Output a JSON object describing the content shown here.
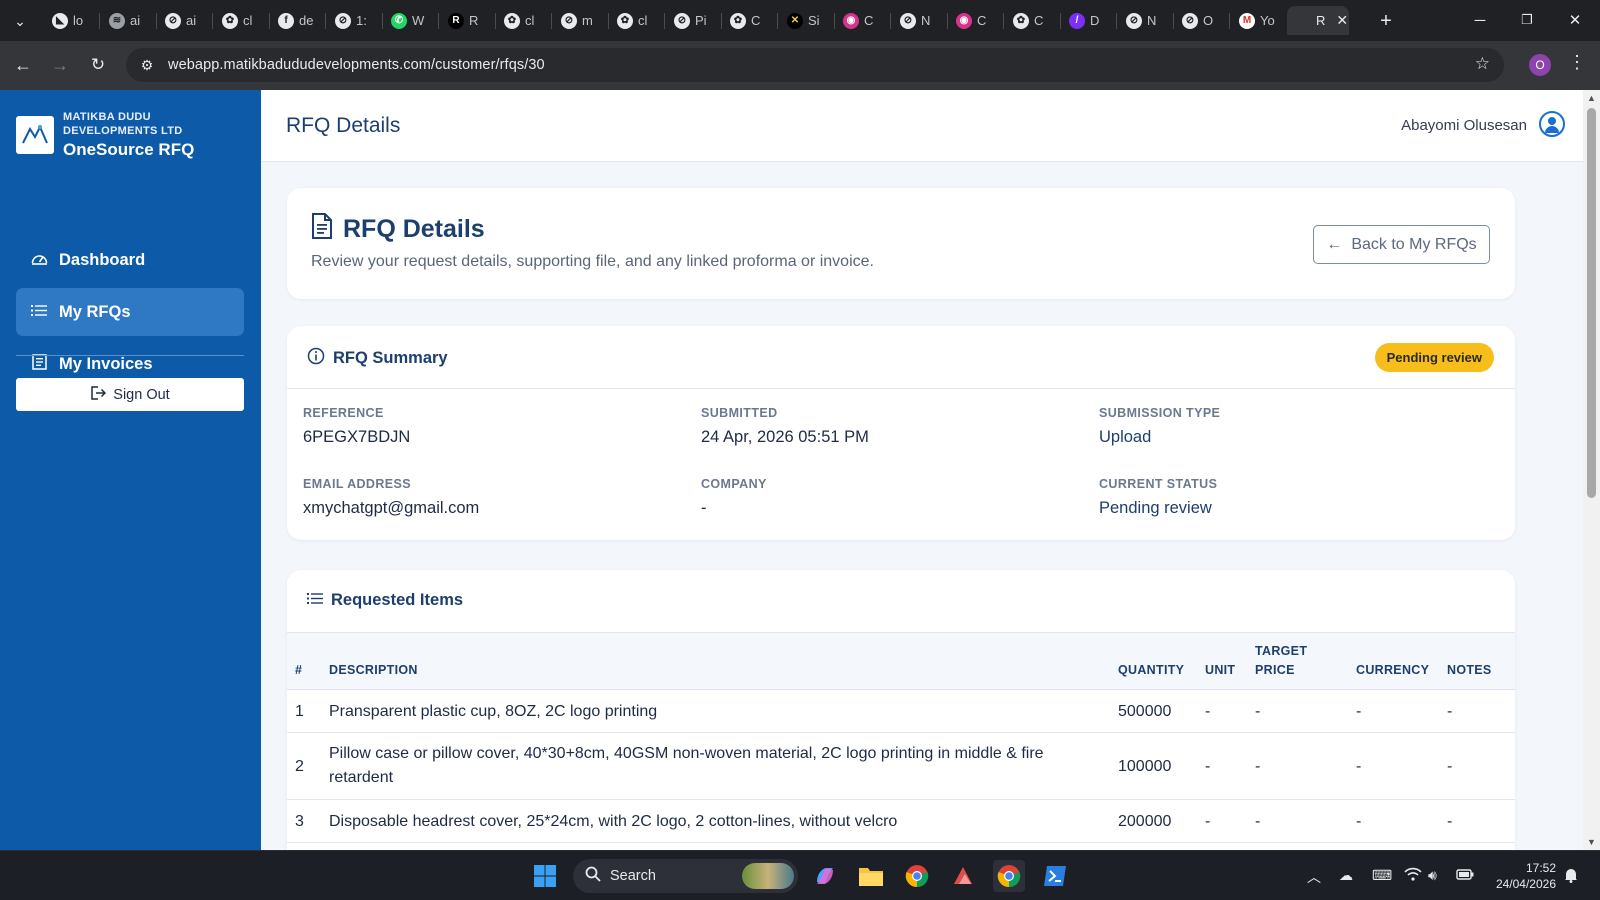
{
  "browser": {
    "tabs": [
      {
        "label": "lo",
        "icon": "pdf-icon"
      },
      {
        "label": "ai",
        "icon": "sketch-icon"
      },
      {
        "label": "ai",
        "icon": "chatgpt-icon"
      },
      {
        "label": "cl",
        "icon": "openai-icon"
      },
      {
        "label": "de",
        "icon": "facebook-icon"
      },
      {
        "label": "1:",
        "icon": "chatgpt-icon"
      },
      {
        "label": "W",
        "icon": "whatsapp-icon"
      },
      {
        "label": "R",
        "icon": "r-icon"
      },
      {
        "label": "cl",
        "icon": "openai-icon"
      },
      {
        "label": "m",
        "icon": "chatgpt-icon"
      },
      {
        "label": "cl",
        "icon": "openai-icon"
      },
      {
        "label": "Pi",
        "icon": "chatgpt-icon"
      },
      {
        "label": "C",
        "icon": "openai-icon"
      },
      {
        "label": "Si",
        "icon": "x-icon"
      },
      {
        "label": "C",
        "icon": "copilot-icon"
      },
      {
        "label": "N",
        "icon": "chatgpt-icon"
      },
      {
        "label": "C",
        "icon": "copilot-icon"
      },
      {
        "label": "C",
        "icon": "openai-icon"
      },
      {
        "label": "D",
        "icon": "purple-icon"
      },
      {
        "label": "N",
        "icon": "chatgpt-icon"
      },
      {
        "label": "O",
        "icon": "chatgpt-icon"
      },
      {
        "label": "Yo",
        "icon": "gmail-icon"
      },
      {
        "label": "R",
        "icon": "blank-icon",
        "active": true
      }
    ],
    "url": "webapp.matikbadududevelopments.com/customer/rfqs/30",
    "profile_initial": "O"
  },
  "sidebar": {
    "company_line1": "MATIKBA DUDU",
    "company_line2": "DEVELOPMENTS LTD",
    "app_name": "OneSource RFQ",
    "items": [
      {
        "label": "Dashboard",
        "icon": "dashboard-icon",
        "active": false
      },
      {
        "label": "My RFQs",
        "icon": "list-icon",
        "active": true
      },
      {
        "label": "My Invoices",
        "icon": "invoice-icon",
        "active": false
      }
    ],
    "signout_label": "Sign Out"
  },
  "topbar": {
    "title": "RFQ Details",
    "user_name": "Abayomi Olusesan"
  },
  "header_card": {
    "title": "RFQ Details",
    "subtitle": "Review your request details, supporting file, and any linked proforma or invoice.",
    "back_label": "Back to My RFQs"
  },
  "summary": {
    "title": "RFQ Summary",
    "status_badge": "Pending review",
    "status_color": "#f7bd1a",
    "fields": {
      "reference": {
        "label": "REFERENCE",
        "value": "6PEGX7BDJN"
      },
      "submitted": {
        "label": "SUBMITTED",
        "value": "24 Apr, 2026 05:51 PM"
      },
      "submission_type": {
        "label": "SUBMISSION TYPE",
        "value": "Upload"
      },
      "email": {
        "label": "EMAIL ADDRESS",
        "value": "xmychatgpt@gmail.com"
      },
      "company": {
        "label": "COMPANY",
        "value": "-"
      },
      "current_status": {
        "label": "CURRENT STATUS",
        "value": "Pending review"
      }
    }
  },
  "items": {
    "title": "Requested Items",
    "columns": {
      "num": "#",
      "description": "DESCRIPTION",
      "quantity": "QUANTITY",
      "unit": "UNIT",
      "target_price_1": "TARGET",
      "target_price_2": "PRICE",
      "currency": "CURRENCY",
      "notes": "NOTES"
    },
    "rows": [
      {
        "num": "1",
        "description": "Pransparent plastic cup, 8OZ, 2C logo printing",
        "quantity": "500000",
        "unit": "-",
        "target_price": "-",
        "currency": "-",
        "notes": "-"
      },
      {
        "num": "2",
        "description": "Pillow case or pillow cover, 40*30+8cm, 40GSM non-woven material, 2C logo printing in middle & fire retardent",
        "quantity": "100000",
        "unit": "-",
        "target_price": "-",
        "currency": "-",
        "notes": "-"
      },
      {
        "num": "3",
        "description": "Disposable headrest cover, 25*24cm, with 2C logo, 2 cotton-lines, without velcro",
        "quantity": "200000",
        "unit": "-",
        "target_price": "-",
        "currency": "-",
        "notes": "-"
      }
    ]
  },
  "taskbar": {
    "search_label": "Search",
    "time": "17:52",
    "date": "24/04/2026"
  }
}
